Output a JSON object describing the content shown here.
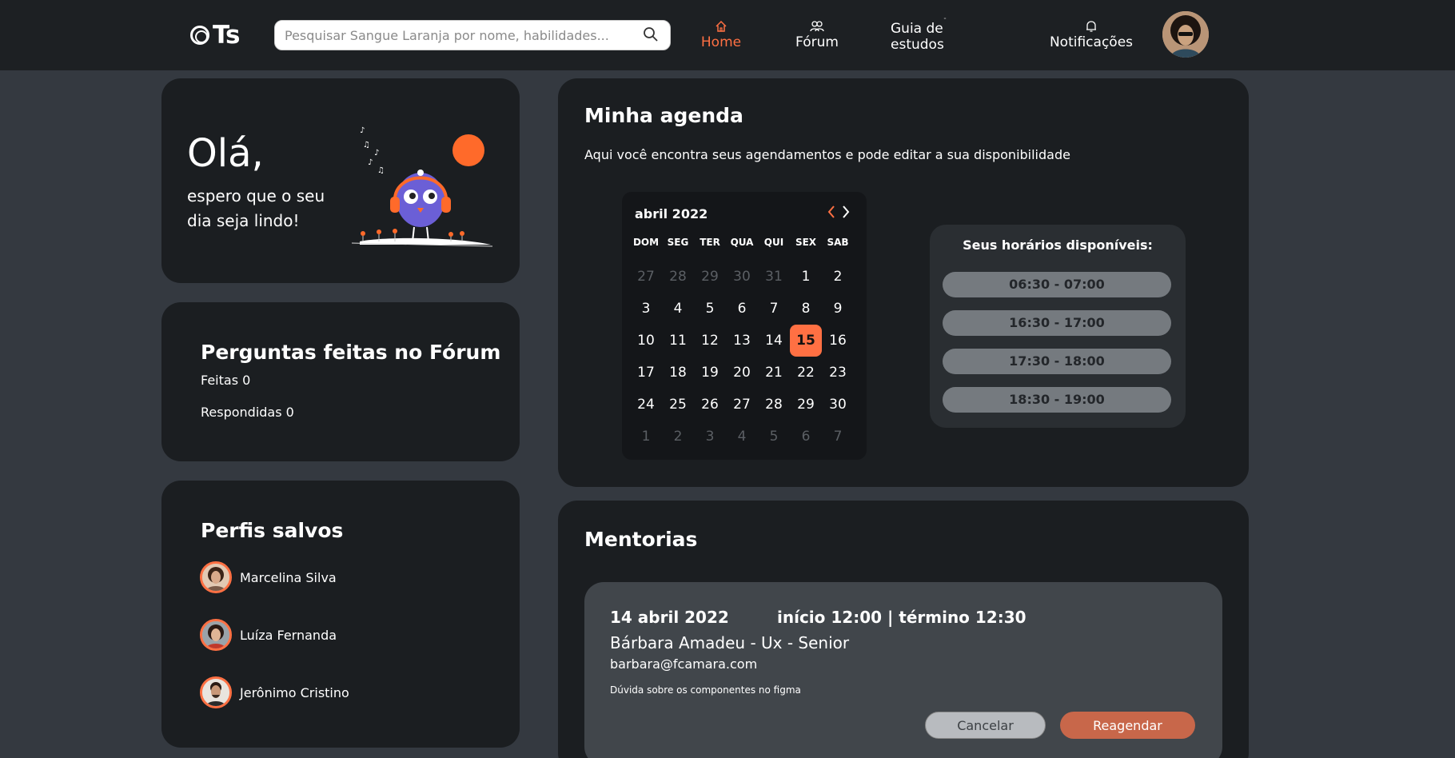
{
  "header": {
    "logo_text": "Ts",
    "search_placeholder": "Pesquisar Sangue Laranja por nome, habilidades...",
    "nav": [
      {
        "label": "Home",
        "icon": "home-icon",
        "active": true
      },
      {
        "label": "Fórum",
        "icon": "users-icon",
        "active": false
      },
      {
        "label": "Guia de estudos",
        "icon": "book-icon",
        "active": false
      },
      {
        "label": "Notificações",
        "icon": "bell-icon",
        "active": false
      }
    ]
  },
  "greeting": {
    "title": "Olá,",
    "subtitle": "espero que o seu dia seja lindo!"
  },
  "forum": {
    "title": "Perguntas feitas no Fórum",
    "asked": "Feitas 0",
    "answered": "Respondidas 0"
  },
  "saved_profiles": {
    "title": "Perfis salvos",
    "profiles": [
      "Marcelina Silva",
      "Luíza Fernanda",
      "Jerônimo Cristino"
    ]
  },
  "agenda": {
    "title": "Minha agenda",
    "subtitle": "Aqui você encontra seus agendamentos e pode editar a sua disponibilidade",
    "calendar": {
      "month": "abril 2022",
      "prev": "‹",
      "next": "›",
      "weekdays": [
        "DOM",
        "SEG",
        "TER",
        "QUA",
        "QUI",
        "SEX",
        "SAB"
      ],
      "weeks": [
        [
          "27",
          "28",
          "29",
          "30",
          "31",
          "1",
          "2"
        ],
        [
          "3",
          "4",
          "5",
          "6",
          "7",
          "8",
          "9"
        ],
        [
          "10",
          "11",
          "12",
          "13",
          "14",
          "15",
          "16"
        ],
        [
          "17",
          "18",
          "19",
          "20",
          "21",
          "22",
          "23"
        ],
        [
          "24",
          "25",
          "26",
          "27",
          "28",
          "29",
          "30"
        ],
        [
          "1",
          "2",
          "3",
          "4",
          "5",
          "6",
          "7"
        ]
      ],
      "selected_day": "15"
    },
    "availability": {
      "title": "Seus horários disponíveis:",
      "slots": [
        "06:30 - 07:00",
        "16:30 - 17:00",
        "17:30 - 18:00",
        "18:30 - 19:00"
      ]
    }
  },
  "mentorias": {
    "title": "Mentorias",
    "item": {
      "date": "14 abril 2022",
      "time": "início 12:00 | término 12:30",
      "mentor": "Bárbara Amadeu - Ux - Senior",
      "email": "barbara@fcamara.com",
      "note": "Dúvida sobre os componentes no figma",
      "cancel_label": "Cancelar",
      "reschedule_label": "Reagendar"
    }
  },
  "colors": {
    "accent": "#ff7043",
    "card_bg": "#1b1e21",
    "page_bg": "#343940",
    "header_bg": "#1d2023",
    "slot_bg": "#757a7f",
    "reschedule_bg": "#c8674a"
  }
}
